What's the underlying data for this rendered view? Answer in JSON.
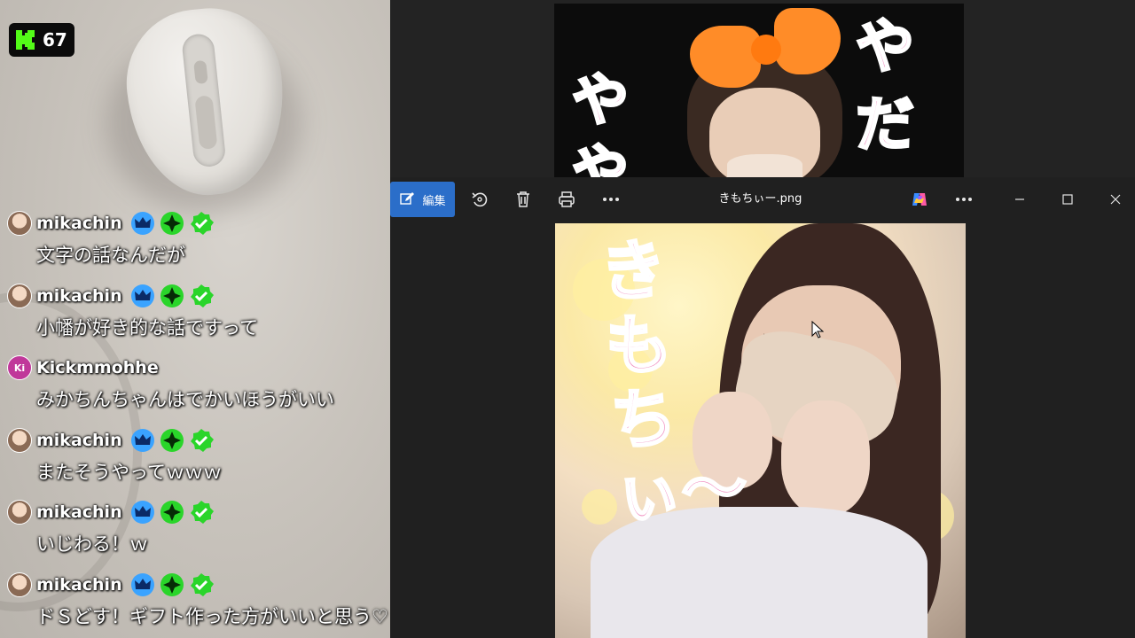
{
  "stream_overlay": {
    "viewer_count": "67",
    "kick_logo_icon": "kick-logo-icon"
  },
  "chat": {
    "messages": [
      {
        "username": "mikachin",
        "text": "文字の話なんだが",
        "avatar": "character-avatar",
        "badges": [
          "crown-badge-icon",
          "sparkle-badge-icon",
          "verified-badge-icon"
        ]
      },
      {
        "username": "mikachin",
        "text": "小幡が好き的な話ですって",
        "avatar": "character-avatar",
        "badges": [
          "crown-badge-icon",
          "sparkle-badge-icon",
          "verified-badge-icon"
        ]
      },
      {
        "username": "Kickmmohhe",
        "text": "みかちんちゃんはでかいほうがいい",
        "avatar_label": "Ki",
        "badges": []
      },
      {
        "username": "mikachin",
        "text": "またそうやってｗｗｗ",
        "avatar": "character-avatar",
        "badges": [
          "crown-badge-icon",
          "sparkle-badge-icon",
          "verified-badge-icon"
        ]
      },
      {
        "username": "mikachin",
        "text": "いじわる！ｗ",
        "avatar": "character-avatar",
        "badges": [
          "crown-badge-icon",
          "sparkle-badge-icon",
          "verified-badge-icon"
        ]
      },
      {
        "username": "mikachin",
        "text": "ドＳどす！ギフト作った方がいいと思う♡",
        "avatar": "character-avatar",
        "badges": [
          "crown-badge-icon",
          "sparkle-badge-icon",
          "verified-badge-icon"
        ]
      }
    ]
  },
  "background_image": {
    "text_left": "やや",
    "text_right": "やだ"
  },
  "viewer_window": {
    "edit_label": "編集",
    "file_name": "きもちぃー.png",
    "toolbar_icons": [
      "rotate-icon",
      "delete-icon",
      "print-icon",
      "more-icon"
    ],
    "right_icons": [
      "copilot-icon",
      "more-icon",
      "minimize-icon",
      "maximize-icon",
      "close-icon"
    ]
  },
  "displayed_image": {
    "overlay_text": "きもちぃ〜"
  },
  "colors": {
    "edit_button": "#2b6ec9",
    "window_bg": "#202020",
    "kick_green": "#53fc18",
    "pink_text": "#f08ec0",
    "bow_orange": "#ff8c28"
  }
}
